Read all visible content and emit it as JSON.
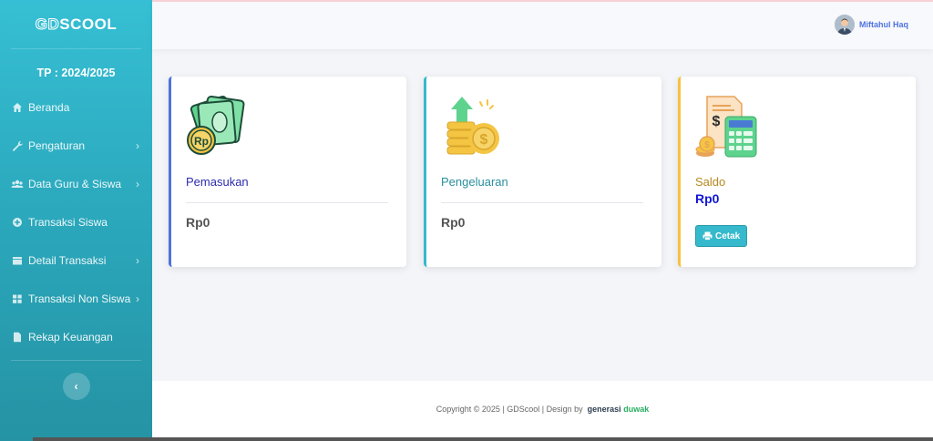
{
  "app": {
    "brand": {
      "part1": "GD",
      "part2": "SCOOL"
    },
    "tahun_pelajaran": "TP : 2024/2025"
  },
  "sidebar": {
    "items": [
      {
        "label": "Beranda",
        "icon": "home-icon",
        "has_submenu": false
      },
      {
        "label": "Pengaturan",
        "icon": "wrench-icon",
        "has_submenu": true
      },
      {
        "label": "Data Guru & Siswa",
        "icon": "users-icon",
        "has_submenu": true
      },
      {
        "label": "Transaksi Siswa",
        "icon": "plus-circle-icon",
        "has_submenu": false
      },
      {
        "label": "Detail Transaksi",
        "icon": "table-icon",
        "has_submenu": true
      },
      {
        "label": "Transaksi Non Siswa",
        "icon": "grid-icon",
        "has_submenu": true
      },
      {
        "label": "Rekap Keuangan",
        "icon": "file-icon",
        "has_submenu": false
      }
    ],
    "chevron": "›",
    "toggle_symbol": "‹"
  },
  "topbar": {
    "user_name": "Miftahul Haq"
  },
  "cards": {
    "pemasukan": {
      "title": "Pemasukan",
      "value": "Rp0",
      "accent": "#4e73df"
    },
    "pengeluaran": {
      "title": "Pengeluaran",
      "value": "Rp0",
      "accent": "#36b9cc"
    },
    "saldo": {
      "title": "Saldo",
      "value": "Rp0",
      "accent": "#f6c23e",
      "button_label": "Cetak"
    }
  },
  "footer": {
    "copyright": "Copyright © 2025 | GDScool | Design by",
    "brand_part1": "generasi",
    "brand_part2": "duwak"
  }
}
